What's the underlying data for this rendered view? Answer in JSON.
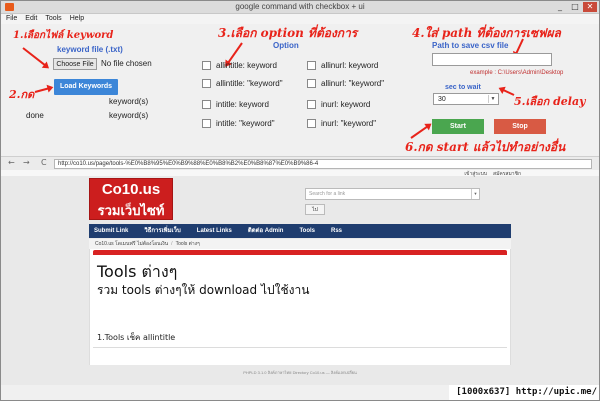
{
  "window": {
    "title": "google command with checkbox + ui",
    "minimize": "_",
    "maximize": "□",
    "close": "✕"
  },
  "menu": [
    "File",
    "Edit",
    "Tools",
    "Help"
  ],
  "annotations": {
    "a1": "1.เลือกไฟล์ keyword",
    "a2": "2.กด",
    "a3": "3.เลือก option ที่ต้องการ",
    "a4": "4.ใส่ path ที่ต้องการเซฟผล",
    "a5": "5.เลือก delay",
    "a6": "6.กด start แล้วไปทำอย่างอื่น"
  },
  "file_section": {
    "label": "keyword file (.txt)",
    "choose_button": "Choose File",
    "no_file": "No file chosen",
    "load_button": "Load Keywords",
    "keyword_count_label": "keyword(s)",
    "done_label": "done",
    "done_count_label": "keyword(s)"
  },
  "options": {
    "title": "Option",
    "items": [
      "allintitle: keyword",
      "allinurl: keyword",
      "allintitle: \"keyword\"",
      "allinurl: \"keyword\"",
      "intitle: keyword",
      "inurl: keyword",
      "intitle: \"keyword\"",
      "inurl: \"keyword\""
    ]
  },
  "path_section": {
    "label": "Path to save csv file",
    "value": "",
    "example": "example : C:\\Users\\Admin\\Desktop"
  },
  "wait_section": {
    "label": "sec to wait",
    "selected": "30"
  },
  "controls": {
    "start": "Start",
    "stop": "Stop"
  },
  "browser": {
    "back": "←",
    "forward": "→",
    "reload": "C",
    "url": "http://co10.us/page/tools-%E0%B8%95%E0%B9%88%E0%B8%B2%E0%B8%87%E0%B9%86-4"
  },
  "site": {
    "top_links": [
      "เข้าสู่ระบบ",
      "สมัครสมาชิก"
    ],
    "logo_line1": "Co10.us",
    "logo_line2": "รวมเว็บไซท์",
    "search_placeholder": "Search for a link",
    "search_button": "ไป",
    "nav": [
      "Submit Link",
      "วิธีการเพิ่มเว็บ",
      "Latest Links",
      "ติดต่อ Admin",
      "Tools",
      "Rss"
    ],
    "breadcrumb": [
      "Co10.us โดเมนฟรี ไม่ต้องโอนเงิน",
      "Tools ต่างๆ"
    ],
    "page_title": "Tools ต่างๆ",
    "page_subtitle": "รวม tools ต่างๆให้ download ไปใช้งาน",
    "first_item": "1.Tools เช็ค allintitle",
    "footer": "PHPLD 3.1.0 ลิงค์ภาษาไทย Directory Co10.us — ลิงค์แลกเปลี่ยน"
  },
  "watermark": "[1000x637] http://upic.me/"
}
